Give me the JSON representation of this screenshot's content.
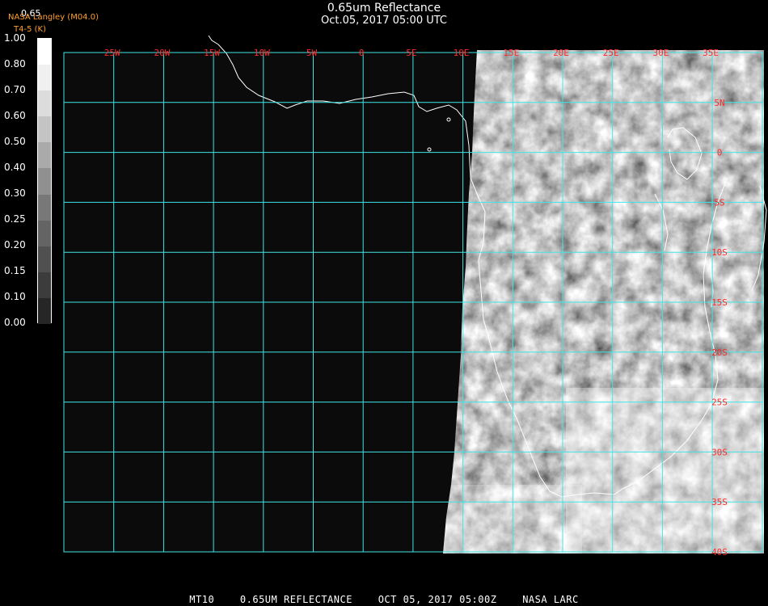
{
  "header": {
    "title": "0.65um Reflectance",
    "subtitle": "Oct.05, 2017 05:00 UTC",
    "credit_line1": "NASA Langley (M04.0)",
    "credit_line2": "T4-5 (K)",
    "band_label": "0.65"
  },
  "colorbar": {
    "ticks": [
      "1.00",
      "0.80",
      "0.70",
      "0.60",
      "0.50",
      "0.40",
      "0.30",
      "0.25",
      "0.20",
      "0.15",
      "0.10",
      "0.00"
    ],
    "shades": [
      "#ffffff",
      "#f0f0f0",
      "#dcdcdc",
      "#c4c4c4",
      "#aaaaaa",
      "#909090",
      "#787878",
      "#646464",
      "#505050",
      "#3c3c3c",
      "#262626"
    ]
  },
  "map": {
    "longitude_labels": [
      "25W",
      "20W",
      "15W",
      "10W",
      "5W",
      "0",
      "5E",
      "10E",
      "15E",
      "20E",
      "25E",
      "30E",
      "35E"
    ],
    "latitude_labels": [
      "5N",
      "0",
      "5S",
      "10S",
      "15S",
      "20S",
      "25S",
      "30S",
      "35S",
      "40S"
    ],
    "grid_color": "#3fe6e6",
    "label_color": "#ff2a2a"
  },
  "footer": {
    "product": "MT10",
    "channel": "0.65UM REFLECTANCE",
    "datetime": "OCT 05, 2017 05:00Z",
    "agency": "NASA LARC"
  }
}
